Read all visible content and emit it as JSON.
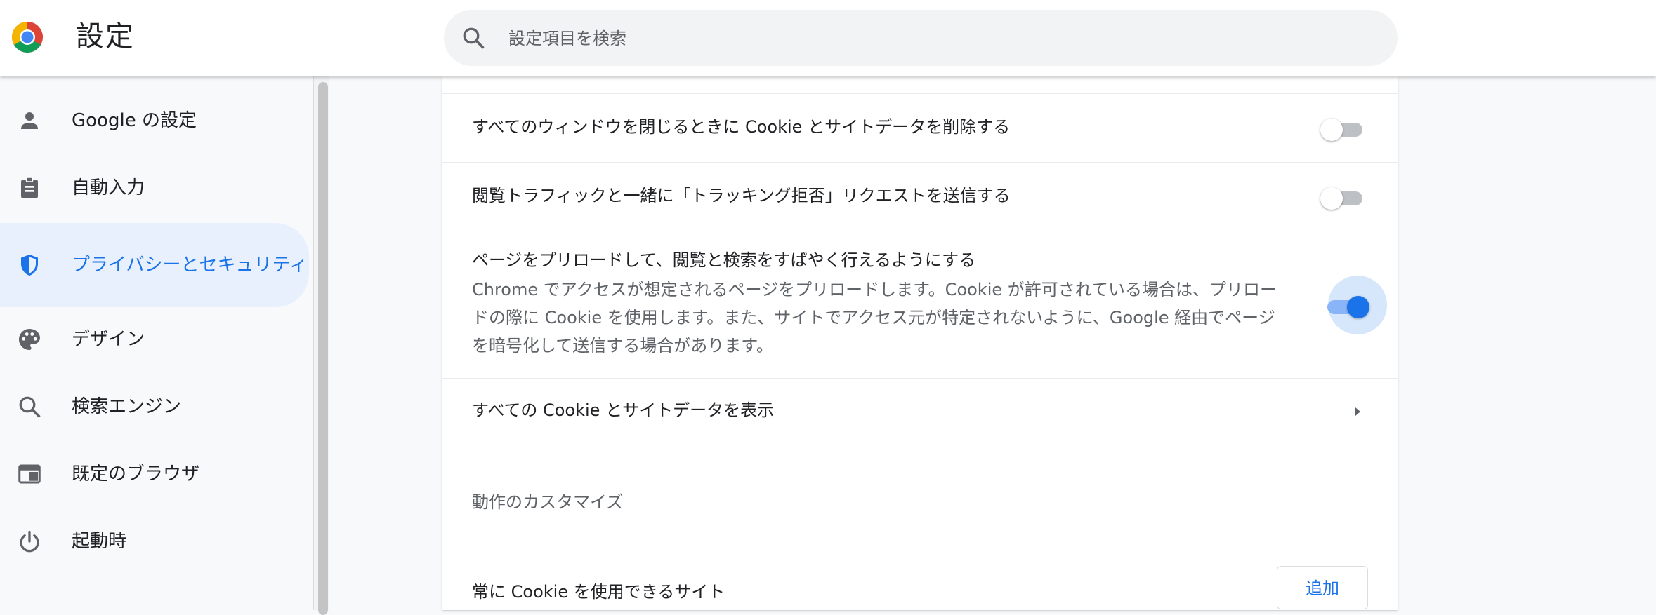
{
  "header": {
    "title": "設定",
    "search_placeholder": "設定項目を検索",
    "logo_icon": "chrome-logo-icon",
    "search_icon": "search-icon"
  },
  "sidebar": {
    "items": [
      {
        "label": "Google の設定",
        "icon": "person-icon",
        "active": false
      },
      {
        "label": "自動入力",
        "icon": "clipboard-icon",
        "active": false
      },
      {
        "label": "プライバシーとセキュリティ",
        "icon": "shield-icon",
        "active": true
      },
      {
        "label": "デザイン",
        "icon": "palette-icon",
        "active": false
      },
      {
        "label": "検索エンジン",
        "icon": "search-icon",
        "active": false
      },
      {
        "label": "既定のブラウザ",
        "icon": "browser-window-icon",
        "active": false
      },
      {
        "label": "起動時",
        "icon": "power-icon",
        "active": false
      }
    ]
  },
  "main": {
    "settings": [
      {
        "label": "すべてのウィンドウを閉じるときに Cookie とサイトデータを削除する",
        "enabled": false
      },
      {
        "label": "閲覧トラフィックと一緒に「トラッキング拒否」リクエストを送信する",
        "enabled": false
      },
      {
        "label": "ページをプリロードして、閲覧と検索をすばやく行えるようにする",
        "description": "Chrome でアクセスが想定されるページをプリロードします。Cookie が許可されている場合は、プリロードの際に Cookie を使用します。また、サイトでアクセス元が特定されないように、Google 経由でページを暗号化して送信する場合があります。",
        "enabled": true
      }
    ],
    "view_all_cookies_label": "すべての Cookie とサイトデータを表示",
    "customize_section_title": "動作のカスタマイズ",
    "always_allow_label": "常に Cookie を使用できるサイト",
    "add_button_label": "追加"
  },
  "colors": {
    "accent": "#1a73e8",
    "active_nav_bg": "#e8f0fe",
    "page_bg": "#f8f9fa",
    "secondary_text": "#5f6368"
  }
}
